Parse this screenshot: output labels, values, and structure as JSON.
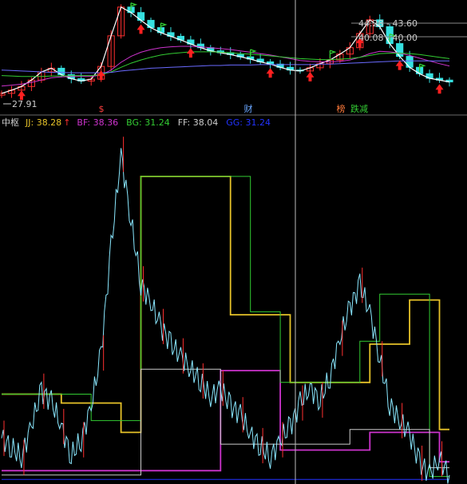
{
  "chart_data": [
    {
      "type": "line",
      "panel": "price",
      "subtype": "candlestick",
      "annotations": {
        "low_label": "27.91",
        "range_labels": [
          "44.28 - 43.60",
          "40.08 - 40.00"
        ],
        "marker_labels": [
          "$",
          "财",
          "榜",
          "跌减"
        ]
      },
      "candles_note": "",
      "series": [
        {
          "name": "",
          "color": "#ffffff",
          "values": [
            27.9,
            28.6,
            29.4,
            30.8,
            32.6,
            33.4,
            32.0,
            31.1,
            30.6,
            31.0,
            33.8,
            40.5,
            46.8,
            45.6,
            43.9,
            42.3,
            41.2,
            40.4,
            39.6,
            38.7,
            37.9,
            37.2,
            36.8,
            36.4,
            35.9,
            35.4,
            34.8,
            34.3,
            33.6,
            33.0,
            32.8,
            33.5,
            34.4,
            35.2,
            36.5,
            37.9,
            41.0,
            44.0,
            42.5,
            38.8,
            36.0,
            33.6,
            32.2,
            31.2,
            30.8,
            30.4
          ]
        },
        {
          "name": "",
          "color": "#cc33cc",
          "values": [
            29.5,
            29.7,
            29.9,
            30.3,
            30.8,
            31.3,
            31.5,
            31.6,
            31.6,
            31.6,
            31.9,
            33.0,
            34.7,
            36.0,
            36.9,
            37.5,
            37.9,
            38.1,
            38.2,
            38.2,
            38.1,
            37.9,
            37.7,
            37.5,
            37.2,
            36.9,
            36.6,
            36.3,
            35.9,
            35.5,
            35.1,
            34.9,
            34.8,
            34.8,
            34.9,
            35.2,
            35.8,
            36.6,
            37.1,
            37.0,
            36.7,
            36.2,
            35.6,
            35.0,
            34.4,
            33.9
          ]
        },
        {
          "name": "",
          "color": "#33cc33",
          "values": [
            31.8,
            31.7,
            31.6,
            31.6,
            31.6,
            31.7,
            31.7,
            31.8,
            31.8,
            31.8,
            32.0,
            32.6,
            33.6,
            34.5,
            35.2,
            35.8,
            36.3,
            36.6,
            36.8,
            37.0,
            37.0,
            37.0,
            36.9,
            36.8,
            36.6,
            36.5,
            36.3,
            36.1,
            35.9,
            35.7,
            35.5,
            35.4,
            35.3,
            35.3,
            35.4,
            35.5,
            35.8,
            36.2,
            36.6,
            36.7,
            36.7,
            36.6,
            36.4,
            36.1,
            35.8,
            35.5
          ]
        },
        {
          "name": "",
          "color": "#6a6aff",
          "values": [
            33.0,
            32.9,
            32.8,
            32.7,
            32.6,
            32.5,
            32.5,
            32.4,
            32.4,
            32.4,
            32.4,
            32.5,
            32.8,
            33.0,
            33.2,
            33.4,
            33.5,
            33.6,
            33.7,
            33.8,
            33.9,
            34.0,
            34.0,
            34.1,
            34.1,
            34.1,
            34.2,
            34.2,
            34.2,
            34.2,
            34.2,
            34.2,
            34.3,
            34.3,
            34.4,
            34.5,
            34.6,
            34.7,
            34.8,
            34.9,
            35.0,
            35.0,
            35.0,
            35.0,
            35.0,
            35.0
          ]
        }
      ],
      "ylim": [
        27.0,
        48.0
      ],
      "grid": false
    },
    {
      "type": "line",
      "panel": "indicator",
      "title": "中枢",
      "legend": [
        {
          "key": "JJ",
          "text": "JJ: 38.28",
          "arrow": "↑",
          "color": "#e6c229"
        },
        {
          "key": "BF",
          "text": "BF: 38.36",
          "color": "#cc33cc"
        },
        {
          "key": "BG",
          "text": "BG: 31.24",
          "color": "#33cc33"
        },
        {
          "key": "FF",
          "text": "FF: 38.04",
          "color": "#cccccc"
        },
        {
          "key": "GG",
          "text": "GG: 31.24",
          "color": "#2233ff"
        }
      ],
      "ylim": [
        28.0,
        52.0
      ],
      "n": 46,
      "series": [
        {
          "name": "price",
          "color": "#8ae8ff",
          "values": [
            31.0,
            30.4,
            29.7,
            31.9,
            34.2,
            33.5,
            31.8,
            29.8,
            30.9,
            33.2,
            36.8,
            44.0,
            50.3,
            45.8,
            41.5,
            40.2,
            38.6,
            37.4,
            36.6,
            35.7,
            34.9,
            33.8,
            34.4,
            33.2,
            32.6,
            31.3,
            30.5,
            29.7,
            30.9,
            31.8,
            33.4,
            34.4,
            33.6,
            35.2,
            37.8,
            39.9,
            41.4,
            39.6,
            36.4,
            33.3,
            32.2,
            31.3,
            29.3,
            28.6,
            29.6,
            28.5
          ]
        },
        {
          "name": "JJ",
          "color": "#e6c229",
          "values": [
            34.0,
            34.0,
            34.0,
            34.0,
            34.0,
            34.0,
            33.4,
            33.4,
            33.4,
            33.4,
            33.4,
            33.4,
            31.4,
            31.4,
            48.8,
            48.8,
            48.8,
            48.8,
            48.8,
            48.8,
            48.8,
            48.8,
            48.8,
            39.4,
            39.4,
            39.4,
            39.4,
            39.4,
            39.4,
            34.8,
            34.8,
            34.8,
            34.8,
            34.8,
            34.8,
            34.8,
            34.8,
            37.4,
            37.4,
            37.4,
            37.4,
            40.4,
            40.4,
            40.4,
            31.6,
            31.6
          ]
        },
        {
          "name": "BF",
          "color": "#cc33cc",
          "values": [
            28.8,
            28.8,
            28.8,
            28.8,
            28.8,
            28.8,
            28.8,
            28.8,
            28.8,
            28.8,
            28.8,
            28.8,
            28.8,
            28.8,
            28.8,
            28.8,
            28.8,
            28.8,
            28.8,
            28.8,
            28.8,
            28.8,
            35.6,
            35.6,
            35.6,
            35.6,
            35.6,
            35.6,
            30.2,
            30.2,
            30.2,
            30.2,
            30.2,
            30.2,
            30.2,
            30.2,
            30.2,
            31.4,
            31.4,
            31.4,
            31.4,
            31.4,
            31.4,
            31.4,
            29.4,
            29.4
          ]
        },
        {
          "name": "BG",
          "color": "#33cc33",
          "values": [
            34.0,
            34.0,
            34.0,
            34.0,
            34.0,
            34.0,
            34.0,
            34.0,
            34.0,
            32.2,
            32.2,
            32.2,
            32.2,
            32.2,
            48.8,
            48.8,
            48.8,
            48.8,
            48.8,
            48.8,
            48.8,
            48.8,
            48.8,
            48.8,
            48.8,
            39.6,
            39.6,
            39.6,
            34.8,
            34.8,
            34.8,
            34.8,
            34.8,
            34.8,
            34.8,
            34.8,
            37.6,
            37.6,
            40.8,
            40.8,
            40.8,
            40.8,
            40.8,
            28.4,
            28.4,
            28.4
          ]
        },
        {
          "name": "FF",
          "color": "#cccccc",
          "values": [
            28.5,
            28.5,
            28.5,
            28.5,
            28.5,
            28.5,
            28.5,
            28.5,
            28.5,
            28.5,
            28.5,
            28.5,
            28.5,
            28.5,
            35.7,
            35.7,
            35.7,
            35.7,
            35.7,
            35.7,
            35.7,
            35.7,
            30.6,
            30.6,
            30.6,
            30.6,
            30.6,
            30.6,
            30.6,
            30.6,
            30.6,
            30.6,
            30.6,
            30.6,
            30.6,
            31.6,
            31.6,
            31.6,
            31.6,
            31.6,
            31.6,
            31.6,
            31.6,
            29.0,
            29.0,
            29.0
          ]
        },
        {
          "name": "GG",
          "color": "#2233ff",
          "values": [
            28.2,
            28.2,
            28.2,
            28.2,
            28.2,
            28.2,
            28.2,
            28.2,
            28.2,
            28.2,
            28.2,
            28.2,
            28.2,
            28.2,
            28.2,
            28.2,
            28.2,
            28.2,
            28.2,
            28.2,
            28.2,
            28.2,
            28.2,
            28.2,
            28.2,
            28.2,
            28.2,
            28.2,
            28.2,
            28.2,
            28.2,
            28.2,
            28.2,
            28.2,
            28.2,
            28.2,
            28.2,
            28.2,
            28.2,
            28.2,
            28.2,
            28.2,
            28.2,
            28.2,
            28.2,
            28.2
          ]
        }
      ]
    }
  ],
  "colors": {
    "background": "#000000",
    "separator": "#6a6a6a",
    "crosshair": "#bbbbbb",
    "up_candle": "#ff3030",
    "down_candle": "#36e0e0",
    "buy_arrow": "#ff2020",
    "sell_flag": "#33cc33",
    "label_text": "#cccccc"
  }
}
